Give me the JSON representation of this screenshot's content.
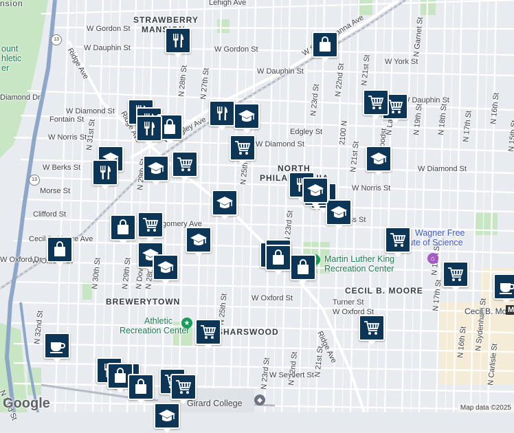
{
  "neighborhoods": [
    "STRAWBERRY MANSION",
    "NORTH PHILADELPHIA WEST",
    "BREWERYTOWN",
    "SHARSWOOD",
    "CECIL B. MOORE"
  ],
  "streets": {
    "w_gordon_top": "W Gordon St",
    "w_gordon": "W Gordon St",
    "w_dauphin_left": "W Dauphin St",
    "w_dauphin_mid": "W Dauphin St",
    "w_dauphin_right": "W Dauphin St",
    "w_york": "W York St",
    "w_susquehanna": "W Susquehanna Ave",
    "w_lehigh_top": "Lehigh Ave",
    "w_diamond_left": "W Diamond St",
    "w_diamond_mid": "W Diamond St",
    "w_diamond_right": "W Diamond St",
    "w_diamond_dr": "Diamond Dr",
    "fontain": "Fontain St",
    "w_norris_left": "W Norris St",
    "w_norris_right": "W Norris St",
    "w_berks": "W Berks St",
    "morse": "Morse St",
    "clifford": "Clifford St",
    "cecil_moore_ave": "Cecil B. Moore Ave",
    "cecil_moore_right": "Cecil B. Moore",
    "w_oxford_left": "W Oxford St",
    "w_oxford_mid": "W Oxford St",
    "w_oxford_right": "W Oxford St",
    "turner": "Turner St",
    "w_seybert": "W Seybert St",
    "edgley_left": "W Edgley Ave",
    "edgley_right": "Edgley St",
    "ridge_ave_top": "Ridge Ave",
    "ridge_ave_bottom": "Ridge Ave",
    "ridge_ave_mid": "Ridge Ave",
    "n_31st": "N 31st St",
    "n_30th": "N 30th St",
    "n_29th": "N 29th St",
    "n_29th_b": "N 29th St",
    "n_28th": "N 28th St",
    "n_28th_b": "N 28th St",
    "n_27th": "N 27th St",
    "n_25th": "N 25th St",
    "n_25th_b": "N 25th St",
    "n_23rd": "N 23rd St",
    "n_23rd_b": "N 23rd St",
    "n_23rd_c": "N 23rd St",
    "n_22nd": "N 22nd St",
    "n_22nd_b": "N 22nd St",
    "n_21st": "N 21st St",
    "n_21st_b": "N 21st St",
    "n_21st_c": "N 21st St",
    "n_2100": "2100 N",
    "n_20th": "N 20th St",
    "n_19th": "N 19th St",
    "n_18th": "N 18th St",
    "n_18th_b": "N 18th St",
    "n_17th": "N 17th St",
    "n_17th_b": "N 17th St",
    "n_16th": "N 16th St",
    "n_16th_b": "N 16th St",
    "n_15th": "N 15th St",
    "n_woodst": "N Woodst",
    "n_lamb": "N Lamb",
    "n_garnet": "N Garnet St",
    "n_dover": "N Dover St",
    "n_32nd": "N 32nd St",
    "n_33rd": "N 33rd St",
    "n_sydenham": "N Sydenham St",
    "n_carlisle": "N Carlisle St",
    "gomery": "gomery Ave",
    "ss_st": "ss St",
    "w_partial": "W",
    "w_oxfo_dr": "W Oxford Dr"
  },
  "pois": {
    "wagner": "Wagner Free Institute of Science",
    "wagner_l1": "Wagner Free",
    "wagner_l2": "Institute of Science",
    "mlk": "Martin Luther King Recreation Center",
    "mlk_l1": "Martin Luther King",
    "mlk_l2": "Recreation Center",
    "athletic_l1": "Athletic",
    "athletic_l2": "Recreation Center",
    "girard": "Girard College",
    "mount_l1": "ount",
    "mount_l2": "hletic",
    "mount_l3": "er",
    "mansion": "nsion"
  },
  "routes": [
    "13",
    "13"
  ],
  "markers": [
    {
      "type": "restaurant-icon"
    },
    {
      "type": "shopping-bag-icon"
    },
    {
      "type": "restaurant-icon"
    },
    {
      "type": "school-icon"
    },
    {
      "type": "restaurant-icon"
    },
    {
      "type": "shopping-cart-icon"
    },
    {
      "type": "shopping-cart-icon"
    },
    {
      "type": "school-icon"
    },
    {
      "type": "restaurant-icon"
    },
    {
      "type": "shopping-bag-icon"
    },
    {
      "type": "restaurant-icon"
    },
    {
      "type": "school-icon"
    },
    {
      "type": "restaurant-icon"
    },
    {
      "type": "shopping-cart-icon"
    },
    {
      "type": "school-icon"
    },
    {
      "type": "shopping-cart-icon"
    },
    {
      "type": "school-icon"
    },
    {
      "type": "restaurant-icon"
    },
    {
      "type": "restaurant-icon"
    },
    {
      "type": "school-icon"
    },
    {
      "type": "school-icon"
    },
    {
      "type": "shopping-bag-icon"
    },
    {
      "type": "shopping-cart-icon"
    },
    {
      "type": "school-icon"
    },
    {
      "type": "shopping-bag-icon"
    },
    {
      "type": "shopping-cart-icon"
    },
    {
      "type": "school-icon"
    },
    {
      "type": "school-icon"
    },
    {
      "type": "shopping-bag-icon"
    },
    {
      "type": "restaurant-icon"
    },
    {
      "type": "restaurant-icon"
    },
    {
      "type": "shopping-bag-icon"
    },
    {
      "type": "shopping-cart-icon"
    },
    {
      "type": "coffee-icon"
    },
    {
      "type": "shopping-cart-icon"
    },
    {
      "type": "coffee-icon"
    },
    {
      "type": "shopping-cart-icon"
    },
    {
      "type": "restaurant-icon"
    },
    {
      "type": "restaurant-icon"
    },
    {
      "type": "shopping-bag-icon"
    },
    {
      "type": "shopping-bag-icon"
    },
    {
      "type": "shopping-cart-icon"
    },
    {
      "type": "shopping-cart-icon"
    },
    {
      "type": "school-icon"
    },
    {
      "type": "school-icon"
    }
  ],
  "branding": {
    "google": "Google",
    "attribution": "Map data ©2025"
  },
  "colors": {
    "marker": "#0d3556",
    "park": "#c7e6c3",
    "highway": "#8ea6c7",
    "water": "#aad3df",
    "land": "#e9ecef",
    "road": "#ffffff"
  }
}
